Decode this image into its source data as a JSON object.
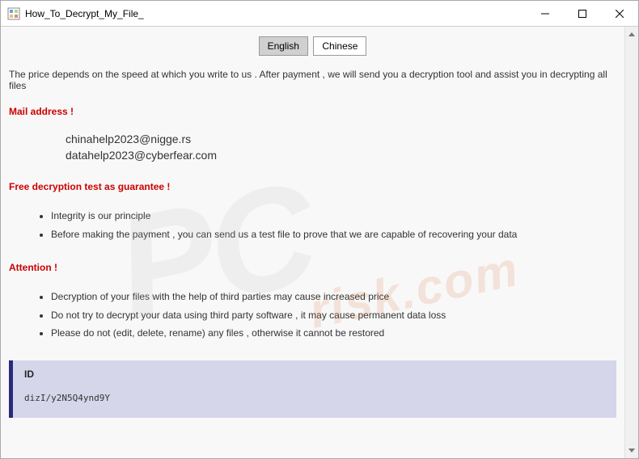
{
  "window": {
    "title": "How_To_Decrypt_My_File_"
  },
  "lang": {
    "english": "English",
    "chinese": "Chinese"
  },
  "intro": "The price depends on the speed at which you write to us . After payment , we will send you a decryption tool and assist you in decrypting all files",
  "mail": {
    "title": "Mail address !",
    "email1": "chinahelp2023@nigge.rs",
    "email2": "datahelp2023@cyberfear.com"
  },
  "guarantee": {
    "title": "Free decryption test as guarantee !",
    "item1": "Integrity is our principle",
    "item2": "Before making the payment , you can send us a test file to prove that we are capable of recovering your data"
  },
  "attention": {
    "title": "Attention !",
    "item1": "Decryption of your files with the help of third parties may cause increased price",
    "item2": "Do not try to decrypt your data using third party software , it may cause permanent data loss",
    "item3": "Please do not (edit, delete, rename) any files , otherwise it cannot be restored"
  },
  "id": {
    "label": "ID",
    "value": "dizI/y2N5Q4ynd9Y"
  },
  "watermark": {
    "main": "PC",
    "sub": "risk.com"
  }
}
